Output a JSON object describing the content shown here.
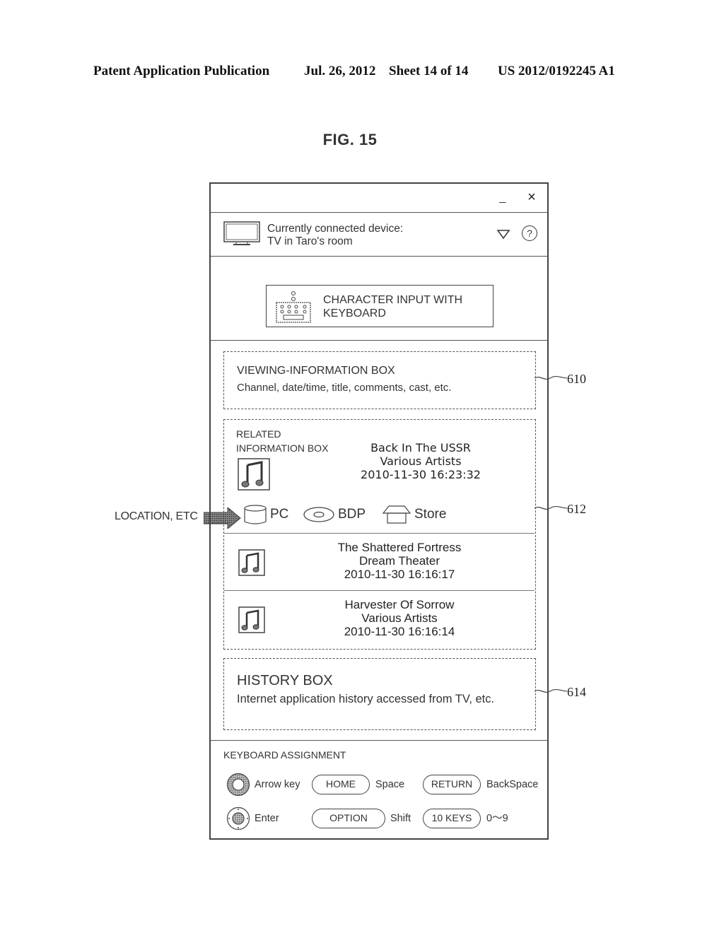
{
  "header": {
    "publication": "Patent Application Publication",
    "date": "Jul. 26, 2012",
    "sheet": "Sheet 14 of 14",
    "number": "US 2012/0192245 A1"
  },
  "figure": {
    "title": "FIG. 15"
  },
  "window": {
    "minimize_icon": "minimize-icon",
    "minimize_glyph": "_",
    "close_icon": "close-icon",
    "close_glyph": "×",
    "device": {
      "icon": "tv-icon",
      "label": "Currently connected device:",
      "name": "TV in Taro's room",
      "dropdown_icon": "triangle-down-icon",
      "help_icon": "help-icon",
      "help_glyph": "?"
    },
    "keyboard_button": {
      "icon": "keyboard-icon",
      "line1": "CHARACTER INPUT WITH",
      "line2": "KEYBOARD"
    },
    "viewing_box": {
      "title": "VIEWING-INFORMATION BOX",
      "subtitle": "Channel, date/time, title, comments, cast, etc."
    },
    "related_box": {
      "label_line1": "RELATED",
      "label_line2": "INFORMATION BOX",
      "current": {
        "icon": "music-note-icon",
        "title": "Back In The USSR",
        "artist": "Various Artists",
        "datetime": "2010-11-30 16:23:32"
      },
      "locations": [
        {
          "icon": "cylinder-icon",
          "label": "PC"
        },
        {
          "icon": "disc-icon",
          "label": "BDP"
        },
        {
          "icon": "store-icon",
          "label": "Store"
        }
      ],
      "items": [
        {
          "icon": "music-note-icon",
          "title": "The Shattered Fortress",
          "artist": "Dream Theater",
          "datetime": "2010-11-30 16:16:17"
        },
        {
          "icon": "music-note-icon",
          "title": "Harvester Of Sorrow",
          "artist": "Various Artists",
          "datetime": "2010-11-30 16:16:14"
        }
      ]
    },
    "history_box": {
      "title": "HISTORY BOX",
      "subtitle": "Internet application history accessed from TV, etc."
    },
    "keyboard_assignment": {
      "title": "KEYBOARD ASSIGNMENT",
      "row1": [
        {
          "control": "ring-dpad-icon",
          "label": "Arrow key"
        },
        {
          "control": "HOME",
          "label": "Space"
        },
        {
          "control": "RETURN",
          "label": "BackSpace"
        }
      ],
      "row2": [
        {
          "control": "center-dpad-icon",
          "label": "Enter"
        },
        {
          "control": "OPTION",
          "label": "Shift"
        },
        {
          "control": "10 KEYS",
          "label": "0〜9"
        }
      ]
    }
  },
  "annotations": {
    "location_label": "LOCATION, ETC",
    "ref_610": "610",
    "ref_612": "612",
    "ref_614": "614"
  }
}
